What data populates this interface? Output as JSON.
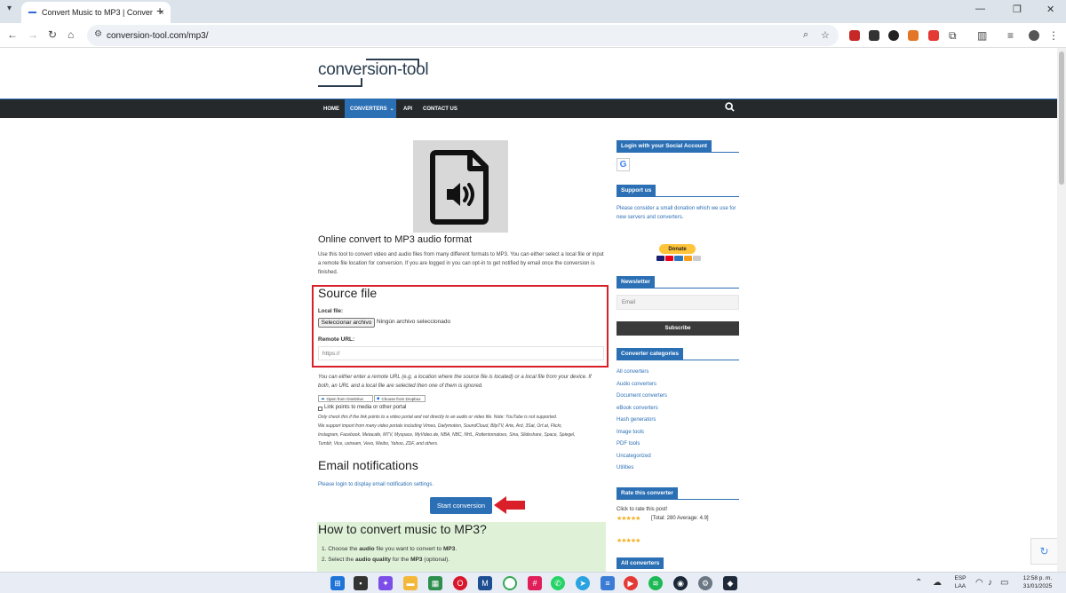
{
  "browser": {
    "tab_title": "Convert Music to MP3 | Conver",
    "tab_close": "×",
    "new_tab": "+",
    "url": "conversion-tool.com/mp3/",
    "win_min": "—",
    "win_max": "❐",
    "win_close": "✕"
  },
  "site": {
    "logo": "conversion-tool",
    "nav": {
      "home": "HOME",
      "converters": "CONVERTERS",
      "api": "API",
      "contact": "CONTACT US"
    }
  },
  "main": {
    "heading": "Online convert to MP3 audio format",
    "intro": "Use this tool to convert video and audio files from many different formats to MP3. You can either select a local file or input a remote file location for conversion. If you are logged in you can opt-in to get notified by email once the conversion is finished.",
    "source_heading": "Source file",
    "local_file_label": "Local file:",
    "file_button": "Seleccionar archivo",
    "file_none": "Ningún archivo seleccionado",
    "remote_url_label": "Remote URL:",
    "remote_url_placeholder": "https://",
    "either_note": "You can either enter a remote URL (e.g. a location where the source file is located) or a local file from your device. If both, an URL and a local file are selected then one of them is ignored.",
    "onedrive": "Open from OneDrive",
    "dropbox": "Choose from Dropbox",
    "portal_label": "Link points to media or other portal",
    "portal_note_1": "Only check this if the link points to a video portal and not directly to an audio or video file. Note: YouTube is not supported.",
    "portal_note_2": "We support import from many video portals including Vimeo, Dailymotion, SoundCloud, BlipTV, Arte, Ard, 3Sat, Orf.at, Flickr,",
    "portal_note_3": "Instagram, Facebook, Metacafe, MTV, Myspace, MyVideo.de, NBA, NBC, NHL, Rottentomatoes, Sina, Slideshare, Space, Spiegel,",
    "portal_note_4": "Tumblr, Vice, ustream, Vevo, Weibo, Yahoo, ZDF, and others.",
    "email_heading": "Email notifications",
    "login_notice": "Please login to display email notification settings.",
    "start_button": "Start conversion",
    "howto_heading": "How to convert music to MP3?",
    "howto_1_a": "1. Choose the ",
    "howto_1_b": "audio",
    "howto_1_c": " file you want to convert to ",
    "howto_1_d": "MP3",
    "howto_1_e": ".",
    "howto_2_a": "2. Select the ",
    "howto_2_b": "audio quality",
    "howto_2_c": " for the ",
    "howto_2_d": "MP3",
    "howto_2_e": " (optional)."
  },
  "sidebar": {
    "social_title": "Login with your Social Account",
    "google_letter": "G",
    "support_title": "Support us",
    "support_text_1": "Please consider a small donation which we use for",
    "support_text_2": "new servers and converters.",
    "donate": "Donate",
    "newsletter_title": "Newsletter",
    "email_placeholder": "Email",
    "subscribe": "Subscribe",
    "categories_title": "Converter categories",
    "categories": [
      "All converters",
      "Audio converters",
      "Document converters",
      "eBook converters",
      "Hash generators",
      "Image tools",
      "PDF tools",
      "Uncategorized",
      "Utilities"
    ],
    "rate_title": "Rate this converter",
    "rate_prompt": "Click to rate this post!",
    "rate_stars": "★★★★★",
    "rate_summary": "[Total: 280 Average: 4.9]",
    "rate_stars_2": "★★★★★",
    "all_converters_title": "All converters"
  },
  "taskbar": {
    "lang_1": "ESP",
    "lang_2": "LAA",
    "time": "12:58 p. m.",
    "date": "31/01/2025"
  },
  "colors": {
    "accent": "#2b6fb5",
    "nav_bg": "#26292c",
    "highlight": "#d9202a",
    "howto_bg": "#dff2d8"
  }
}
